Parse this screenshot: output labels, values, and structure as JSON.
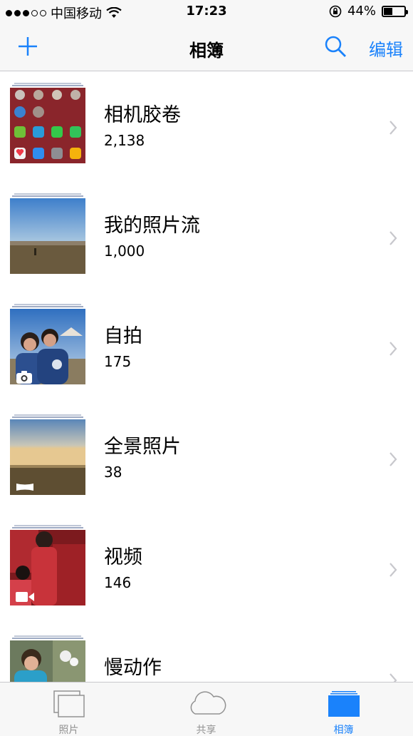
{
  "status_bar": {
    "carrier": "中国移动",
    "time": "17:23",
    "battery_percent": "44%",
    "battery_level": 0.44,
    "signal_bars_filled": 3,
    "signal_bars_total": 5
  },
  "nav": {
    "title": "相簿",
    "edit_label": "编辑",
    "add_icon": "plus-icon",
    "search_icon": "search-icon"
  },
  "albums": [
    {
      "name": "相机胶卷",
      "count": "2,138"
    },
    {
      "name": "我的照片流",
      "count": "1,000"
    },
    {
      "name": "自拍",
      "count": "175",
      "badge_icon": "selfie-camera-icon"
    },
    {
      "name": "全景照片",
      "count": "38",
      "badge_icon": "panorama-icon"
    },
    {
      "name": "视频",
      "count": "146",
      "badge_icon": "video-camera-icon"
    },
    {
      "name": "慢动作",
      "count": ""
    }
  ],
  "tabs": [
    {
      "label": "照片",
      "icon": "photos-icon",
      "active": false
    },
    {
      "label": "共享",
      "icon": "cloud-icon",
      "active": false
    },
    {
      "label": "相簿",
      "icon": "albums-icon",
      "active": true
    }
  ],
  "colors": {
    "accent": "#1a82fb",
    "bar_background": "#f7f7f7",
    "separator": "#c8c7cc",
    "inactive_tab": "#929292"
  }
}
